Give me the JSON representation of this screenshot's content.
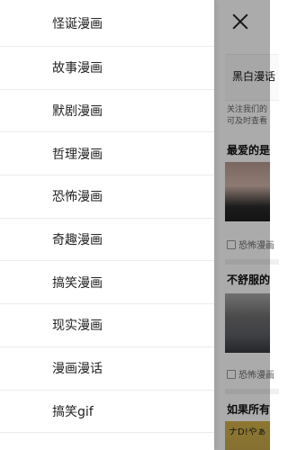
{
  "menu": {
    "items": [
      {
        "label": "怪诞漫画"
      },
      {
        "label": "故事漫画"
      },
      {
        "label": "默剧漫画"
      },
      {
        "label": "哲理漫画"
      },
      {
        "label": "恐怖漫画"
      },
      {
        "label": "奇趣漫画"
      },
      {
        "label": "搞笑漫画"
      },
      {
        "label": "现实漫画"
      },
      {
        "label": "漫画漫话"
      },
      {
        "label": "搞笑gif"
      }
    ]
  },
  "background": {
    "tab_label": "黑白漫话",
    "description_line1": "关注我们的",
    "description_line2": "可及时查看",
    "cards": [
      {
        "title": "最爱的是",
        "tag": "恐怖漫画"
      },
      {
        "title": "不舒服的",
        "tag": "恐怖漫画"
      },
      {
        "title": "如果所有",
        "image_text": "ナD!やぁ"
      }
    ]
  }
}
